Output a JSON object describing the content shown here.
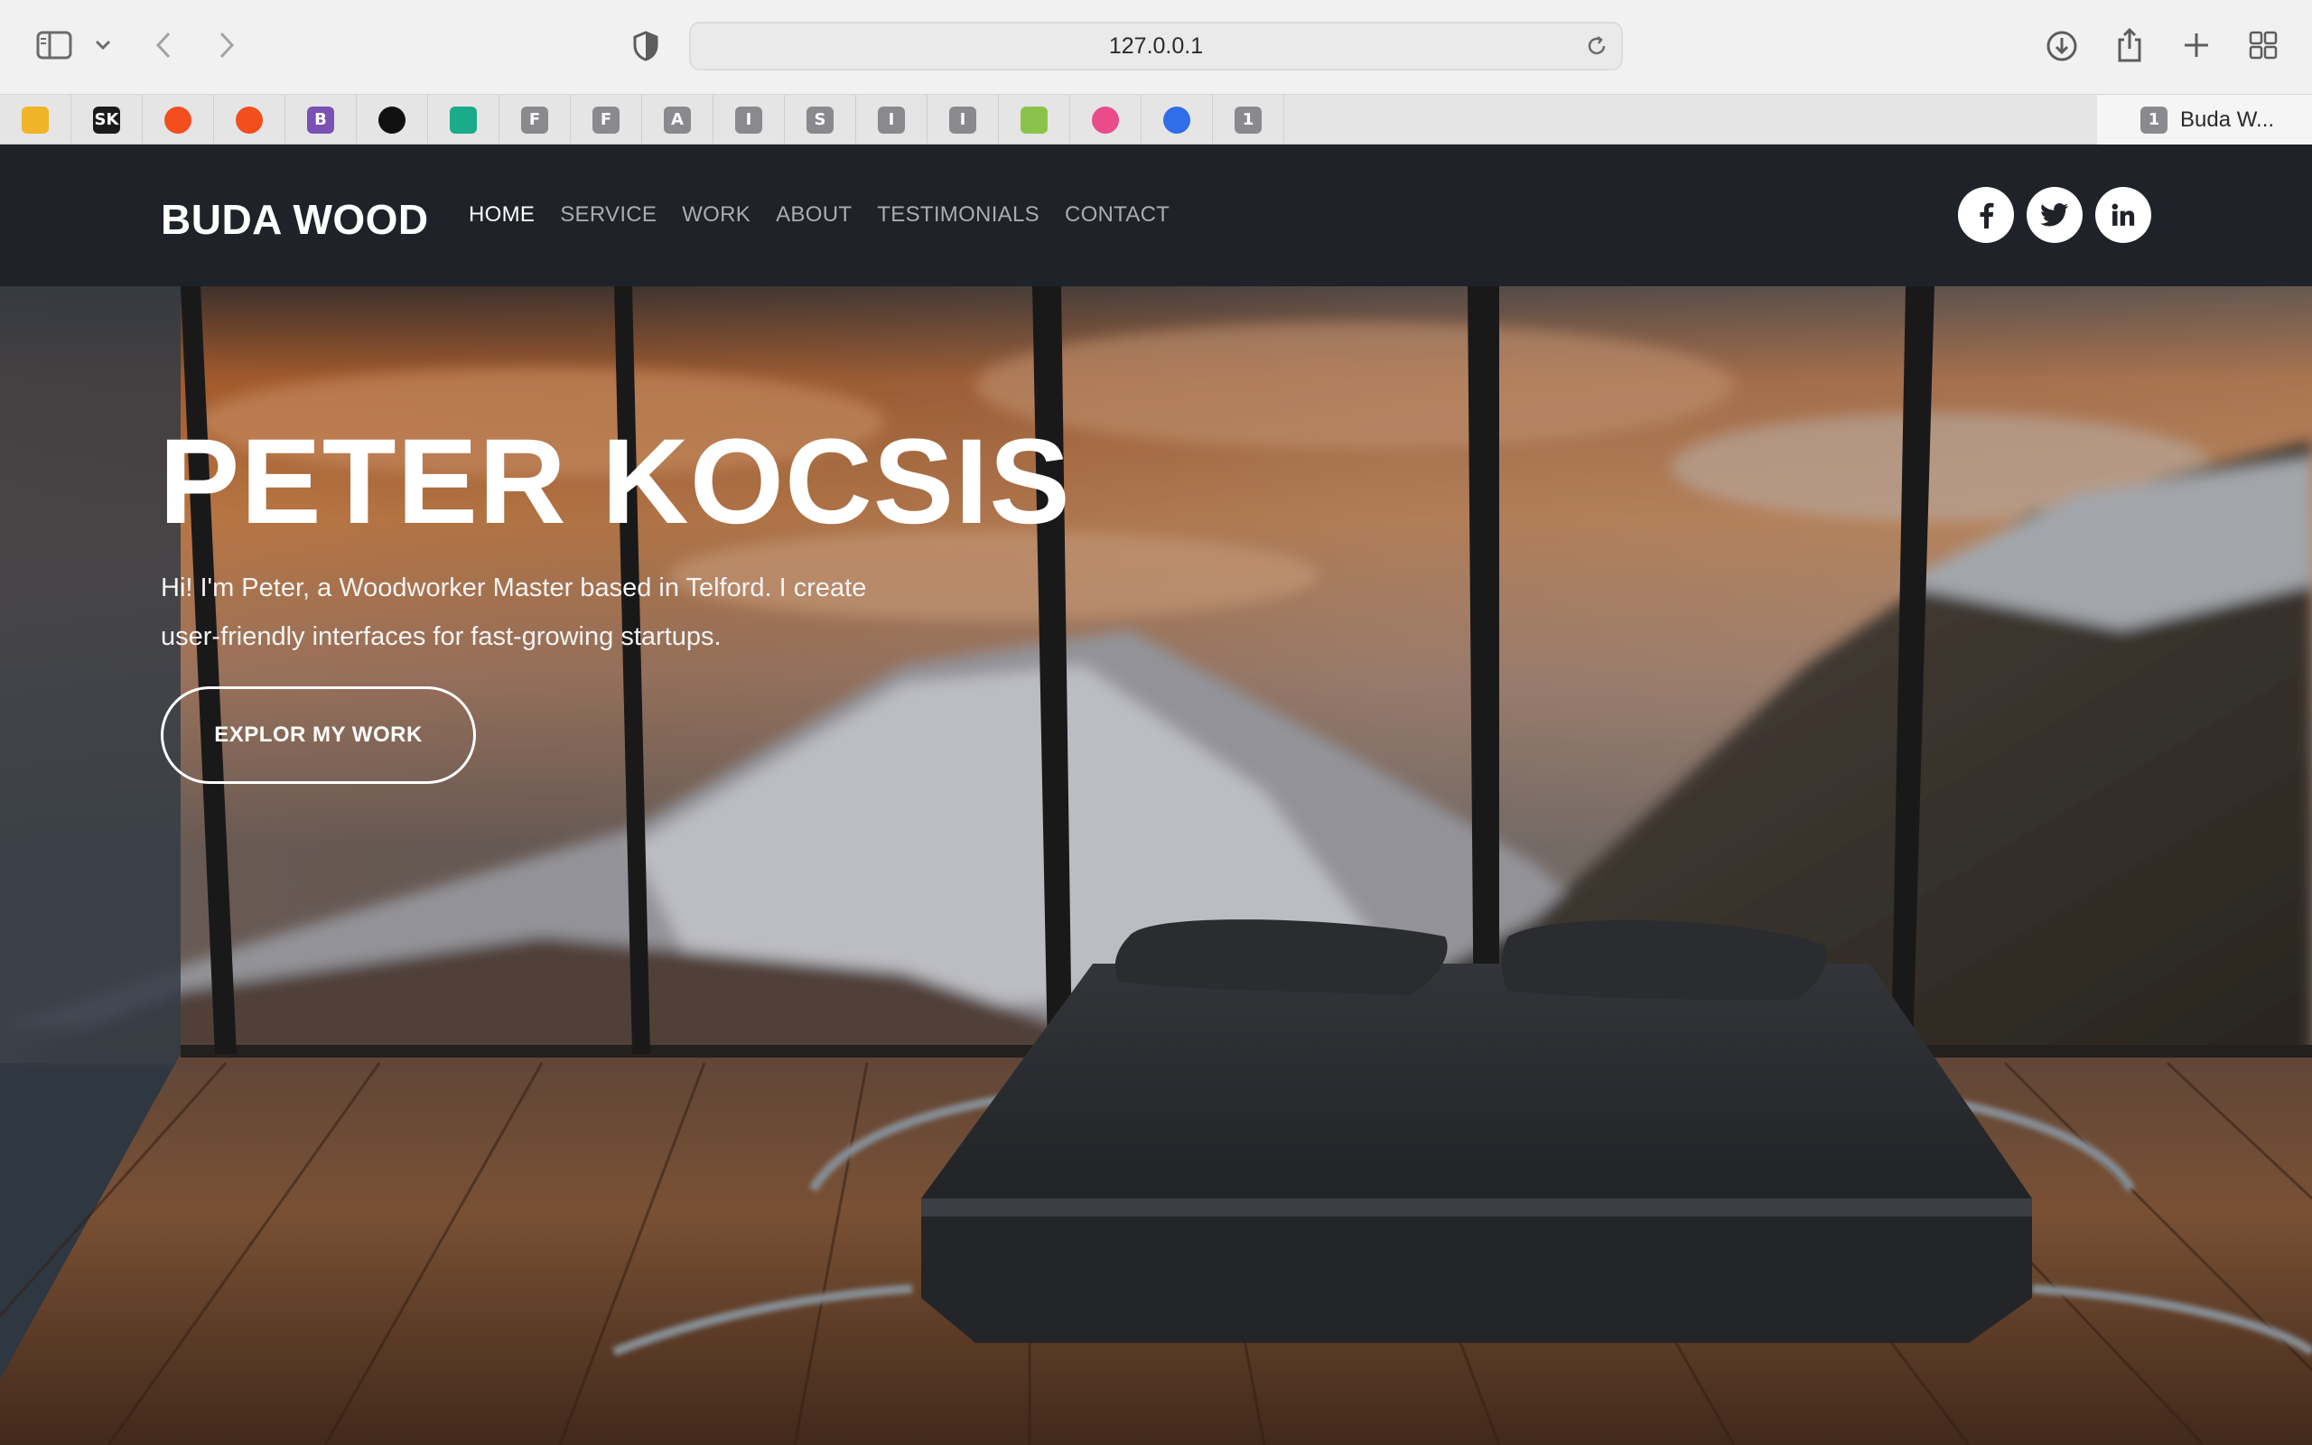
{
  "browser": {
    "url": "127.0.0.1",
    "toolbar_icons": [
      "sidebar-icon",
      "chevron-down-icon",
      "back-icon",
      "forward-icon",
      "privacy-shield-icon",
      "reload-icon",
      "download-icon",
      "share-icon",
      "new-tab-icon",
      "tab-overview-icon"
    ],
    "tabs": [
      {
        "favicon": "",
        "icon": "avatar-favicon",
        "color": "#f0b429"
      },
      {
        "favicon": "SK",
        "icon": "sk-favicon",
        "color": "#1b1b1b"
      },
      {
        "favicon": "",
        "icon": "figma-favicon",
        "color": "#f24e1e"
      },
      {
        "favicon": "",
        "icon": "figma-favicon",
        "color": "#f24e1e"
      },
      {
        "favicon": "B",
        "icon": "bootstrap-favicon",
        "color": "#7952b3"
      },
      {
        "favicon": "",
        "icon": "github-favicon",
        "color": "#111111"
      },
      {
        "favicon": "",
        "icon": "check-diamond-favicon",
        "color": "#1aab8a"
      },
      {
        "favicon": "F",
        "icon": "letter-favicon",
        "color": "#8a8a8e"
      },
      {
        "favicon": "F",
        "icon": "letter-favicon",
        "color": "#8a8a8e"
      },
      {
        "favicon": "A",
        "icon": "letter-favicon",
        "color": "#8a8a8e"
      },
      {
        "favicon": "I",
        "icon": "letter-favicon",
        "color": "#8a8a8e"
      },
      {
        "favicon": "S",
        "icon": "letter-favicon",
        "color": "#8a8a8e"
      },
      {
        "favicon": "I",
        "icon": "letter-favicon",
        "color": "#8a8a8e"
      },
      {
        "favicon": "I",
        "icon": "letter-favicon",
        "color": "#8a8a8e"
      },
      {
        "favicon": "",
        "icon": "green-grid-favicon",
        "color": "#8bc34a"
      },
      {
        "favicon": "",
        "icon": "dribbble-favicon",
        "color": "#ea4c89"
      },
      {
        "favicon": "",
        "icon": "c-swirl-favicon",
        "color": "#2f6ee8"
      },
      {
        "favicon": "1",
        "icon": "letter-favicon",
        "color": "#8a8a8e"
      }
    ],
    "active_tab": {
      "favicon": "1",
      "title": "Buda W..."
    }
  },
  "site": {
    "brand": "BUDA WOOD",
    "nav": [
      {
        "label": "HOME",
        "active": true
      },
      {
        "label": "SERVICE",
        "active": false
      },
      {
        "label": "WORK",
        "active": false
      },
      {
        "label": "ABOUT",
        "active": false
      },
      {
        "label": "TESTIMONIALS",
        "active": false
      },
      {
        "label": "CONTACT",
        "active": false
      }
    ],
    "socials": [
      "facebook-icon",
      "twitter-icon",
      "linkedin-icon"
    ],
    "header_bg": "#1f2228"
  },
  "hero": {
    "title": "PETER KOCSIS",
    "text": "Hi! I'm Peter, a Woodworker Master based in Telford. I create user-friendly interfaces for fast-growing startups.",
    "cta": "EXPLOR MY WORK"
  }
}
